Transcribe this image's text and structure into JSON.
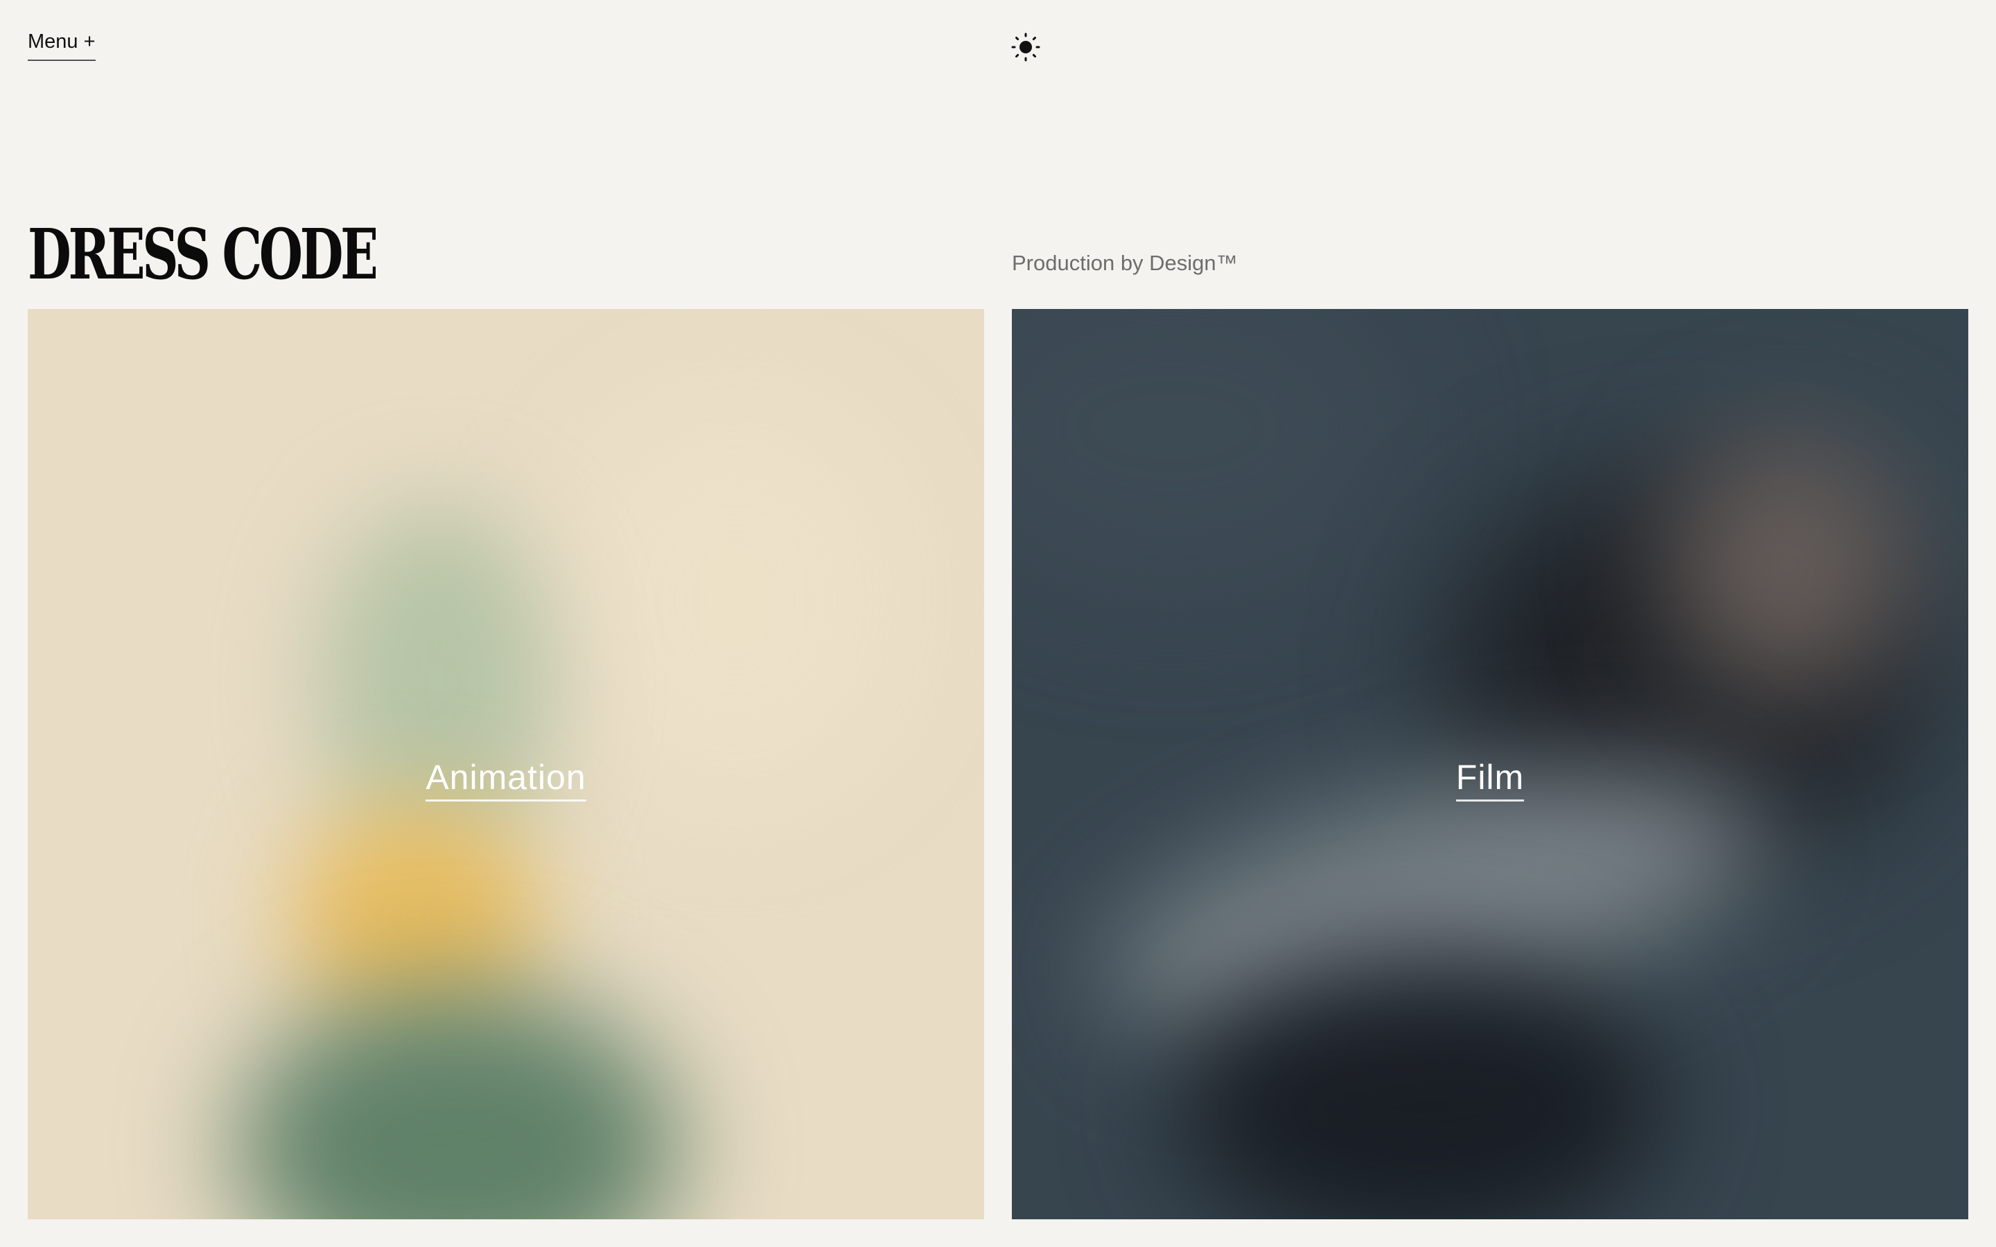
{
  "header": {
    "menu_label": "Menu +",
    "theme_icon": "sun-icon"
  },
  "brand": {
    "logo_text": "DRESS CODE",
    "tagline": "Production by Design™"
  },
  "tiles": [
    {
      "label": "Animation",
      "background": "#e8dcc4"
    },
    {
      "label": "Film",
      "background": "#37454f"
    }
  ],
  "colors": {
    "page_background": "#f4f3ef",
    "text": "#111111",
    "muted_text": "#6d6d6b"
  }
}
